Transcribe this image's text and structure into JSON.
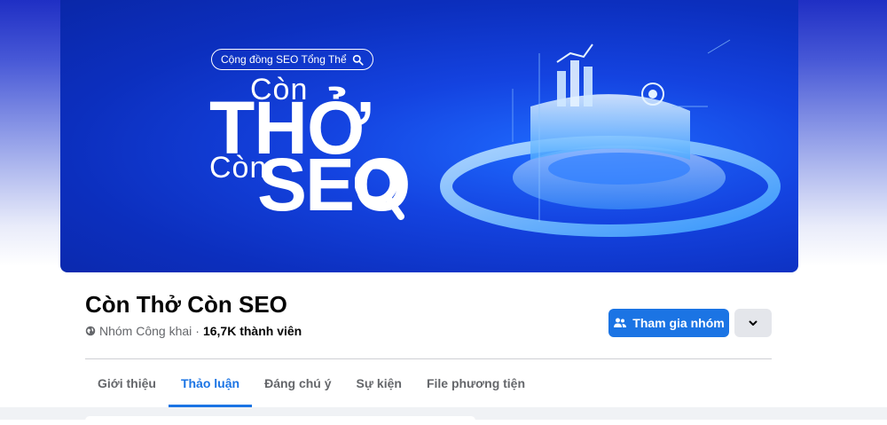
{
  "cover": {
    "pill_text": "Cộng đồng SEO Tổng Thể",
    "line1": "Còn",
    "line2": "THỞ",
    "line3": "Còn",
    "line4": "SEO"
  },
  "group": {
    "title": "Còn Thở Còn SEO",
    "privacy": "Nhóm Công khai",
    "separator": "·",
    "members": "16,7K thành viên"
  },
  "actions": {
    "join_label": "Tham gia nhóm"
  },
  "tabs": [
    {
      "label": "Giới thiệu",
      "active": false
    },
    {
      "label": "Thảo luận",
      "active": true
    },
    {
      "label": "Đáng chú ý",
      "active": false
    },
    {
      "label": "Sự kiện",
      "active": false
    },
    {
      "label": "File phương tiện",
      "active": false
    }
  ],
  "colors": {
    "accent": "#1b74e4",
    "cover_blue": "#0c2fbe"
  }
}
